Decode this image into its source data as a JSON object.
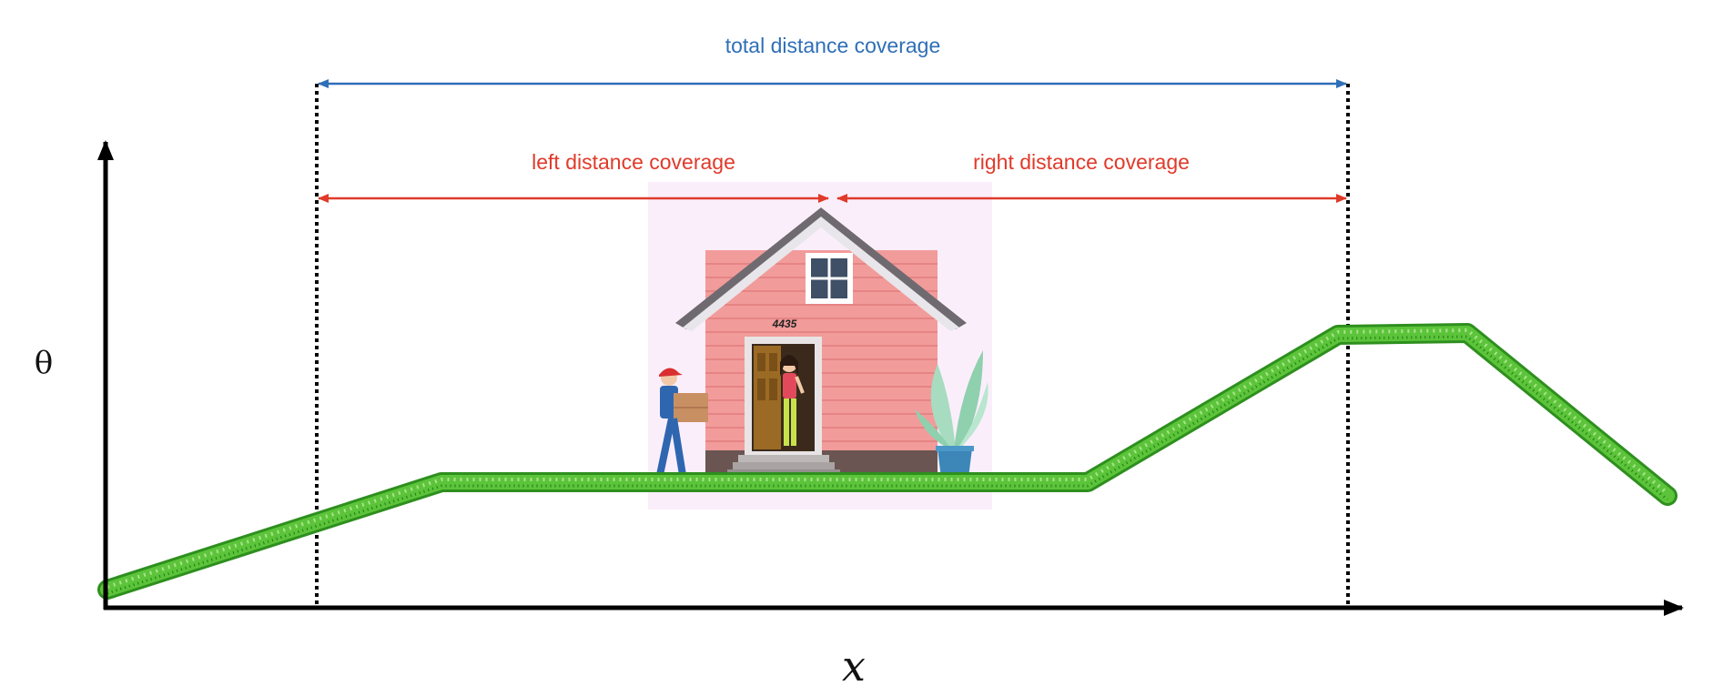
{
  "labels": {
    "total": "total distance coverage",
    "left": "left distance coverage",
    "right": "right distance coverage",
    "y_axis": "θ",
    "x_axis": "x",
    "house_number": "4435"
  },
  "colors": {
    "total_arrow": "#2f6fb7",
    "side_arrows": "#e03a2a",
    "grass": "#5cc43a",
    "house_wall": "#f29b9b",
    "backdrop": "#fbeefb"
  },
  "icons": [
    "house-icon",
    "delivery-person-icon",
    "woman-icon",
    "potted-plant-icon",
    "grass-terrain"
  ]
}
